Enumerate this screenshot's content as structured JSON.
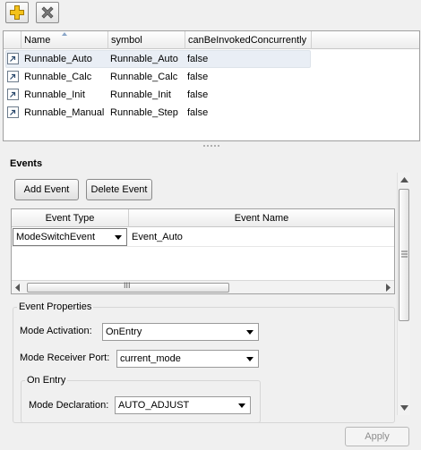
{
  "toolbar": {
    "add_icon": "plus-icon",
    "remove_icon": "x-icon",
    "add_color": "#f4c21a",
    "remove_color": "#6e6e6e"
  },
  "runnables_table": {
    "headers": [
      "Name",
      "symbol",
      "canBeInvokedConcurrently"
    ],
    "sorted_column": "Name",
    "rows": [
      {
        "name": "Runnable_Auto",
        "symbol": "Runnable_Auto",
        "concurrent": "false",
        "selected": true
      },
      {
        "name": "Runnable_Calc",
        "symbol": "Runnable_Calc",
        "concurrent": "false",
        "selected": false
      },
      {
        "name": "Runnable_Init",
        "symbol": "Runnable_Init",
        "concurrent": "false",
        "selected": false
      },
      {
        "name": "Runnable_Manual",
        "symbol": "Runnable_Step",
        "concurrent": "false",
        "selected": false
      }
    ]
  },
  "events": {
    "title": "Events",
    "add_label": "Add Event",
    "delete_label": "Delete Event",
    "headers": [
      "Event Type",
      "Event Name"
    ],
    "rows": [
      {
        "type": "ModeSwitchEvent",
        "name": "Event_Auto"
      }
    ],
    "scroll_thumb_grip": "III"
  },
  "event_properties": {
    "title": "Event Properties",
    "mode_activation_label": "Mode Activation:",
    "mode_activation_value": "OnEntry",
    "receiver_port_label": "Mode Receiver Port:",
    "receiver_port_value": "current_mode",
    "on_entry": {
      "title": "On Entry",
      "mode_declaration_label": "Mode Declaration:",
      "mode_declaration_value": "AUTO_ADJUST"
    }
  },
  "footer": {
    "apply_label": "Apply"
  }
}
